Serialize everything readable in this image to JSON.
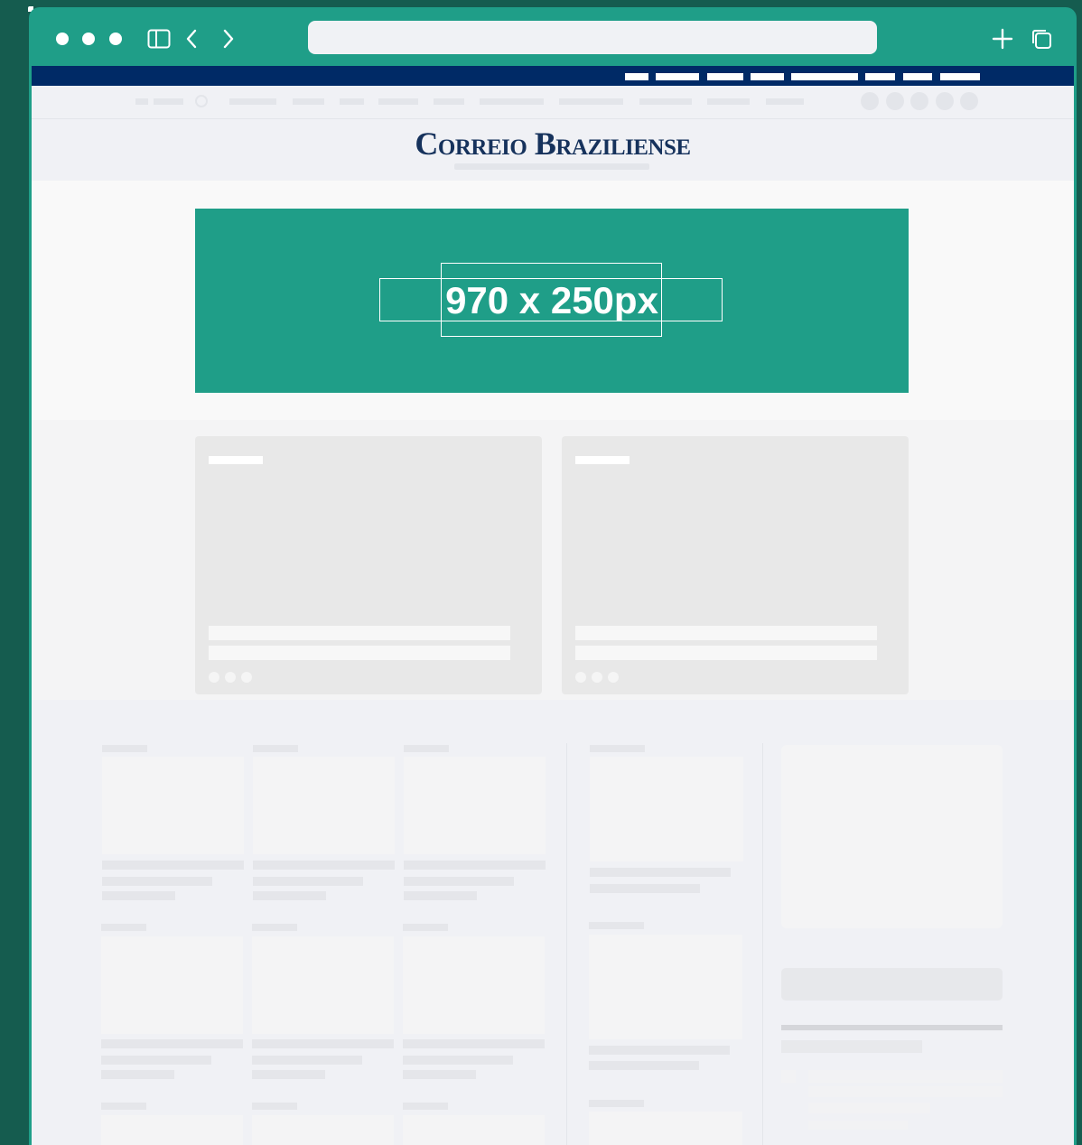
{
  "browser": {
    "address_value": "",
    "icons": [
      "sidebar-icon",
      "back-icon",
      "forward-icon",
      "new-tab-icon",
      "tabs-icon"
    ]
  },
  "site": {
    "logo": "Correio Braziliense"
  },
  "ad": {
    "size_label": "970 x 250px"
  },
  "colors": {
    "browser_chrome": "#1f9e88",
    "desktop": "#155c4f",
    "top_bar": "#002a66",
    "logo": "#16325c",
    "ad_fill": "#1f9e88",
    "page_bg": "#f0f1f5",
    "placeholder": "#e3e5ea"
  }
}
